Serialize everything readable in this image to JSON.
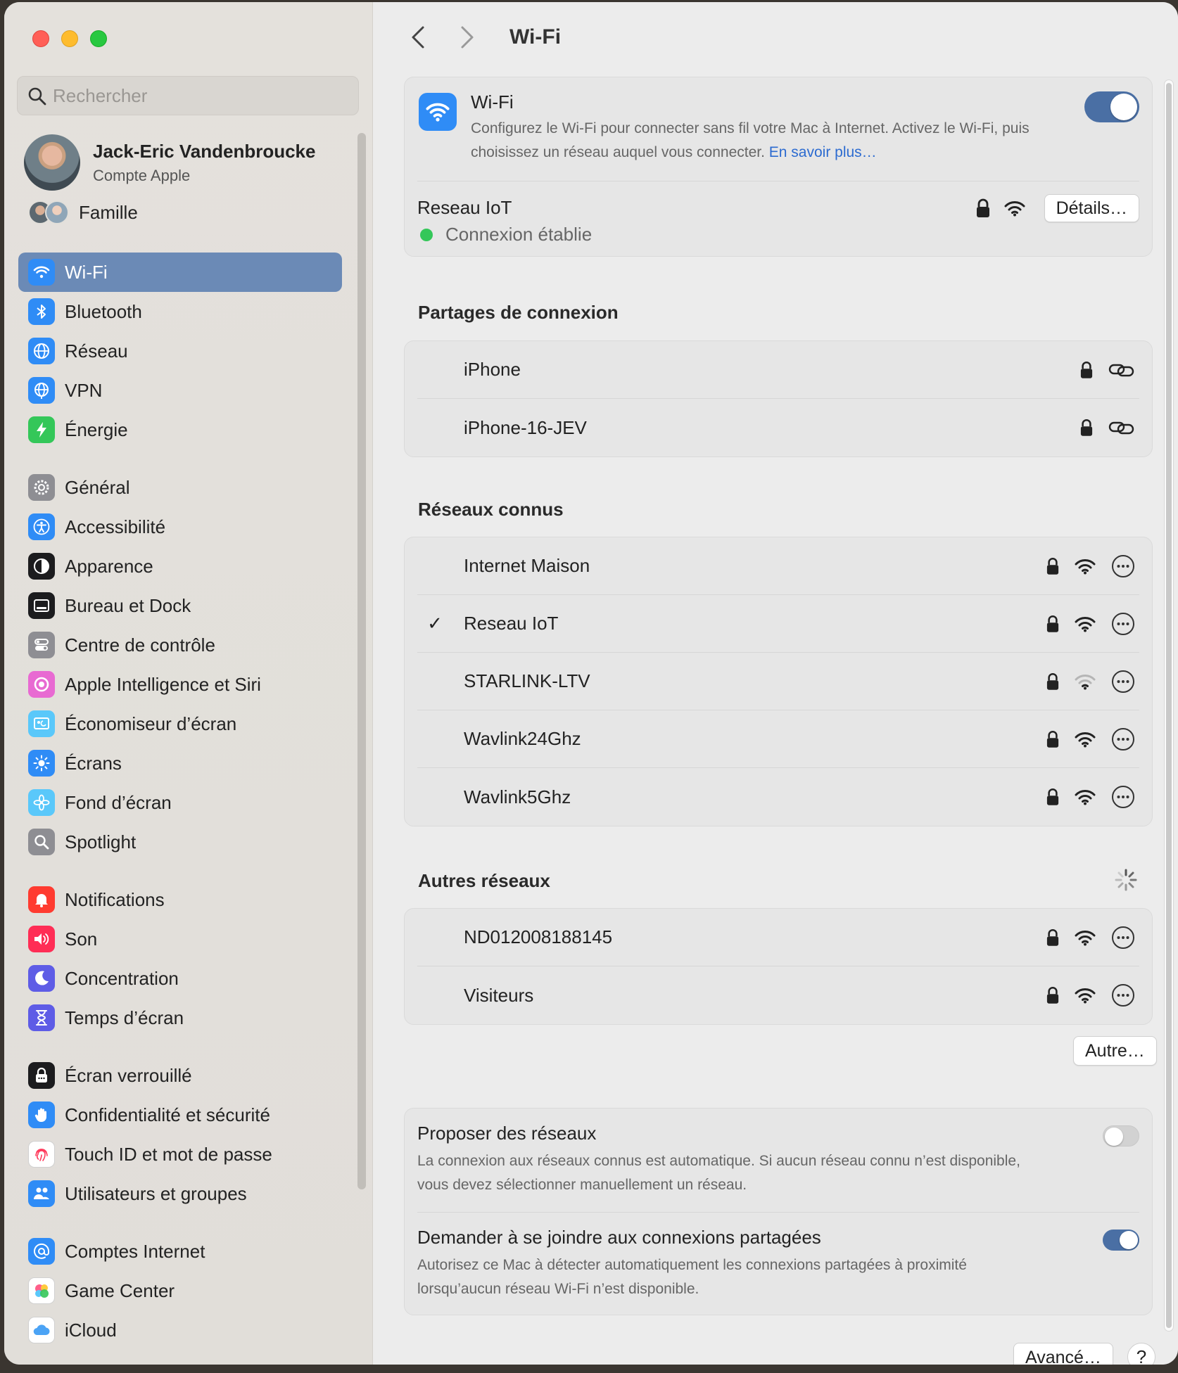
{
  "sidebar": {
    "search_placeholder": "Rechercher",
    "profile": {
      "name": "Jack-Eric Vandenbroucke",
      "subtitle": "Compte Apple"
    },
    "family_label": "Famille",
    "groups": [
      [
        {
          "label": "Wi-Fi",
          "icon": "wifi-icon",
          "color": "#2f8cf6",
          "active": true
        },
        {
          "label": "Bluetooth",
          "icon": "bluetooth-icon",
          "color": "#2f8cf6"
        },
        {
          "label": "Réseau",
          "icon": "globe-icon",
          "color": "#2f8cf6"
        },
        {
          "label": "VPN",
          "icon": "vpn-globe-icon",
          "color": "#2f8cf6"
        },
        {
          "label": "Énergie",
          "icon": "bolt-icon",
          "color": "#34c759"
        }
      ],
      [
        {
          "label": "Général",
          "icon": "gear-icon",
          "color": "#8e8e93"
        },
        {
          "label": "Accessibilité",
          "icon": "accessibility-icon",
          "color": "#2f8cf6"
        },
        {
          "label": "Apparence",
          "icon": "appearance-icon",
          "color": "#1c1c1e"
        },
        {
          "label": "Bureau et Dock",
          "icon": "dock-icon",
          "color": "#1c1c1e"
        },
        {
          "label": "Centre de contrôle",
          "icon": "control-center-icon",
          "color": "#8e8e93"
        },
        {
          "label": "Apple Intelligence et Siri",
          "icon": "siri-icon",
          "color": "#e86ad2"
        },
        {
          "label": "Économiseur d’écran",
          "icon": "screensaver-icon",
          "color": "#5ac8fa"
        },
        {
          "label": "Écrans",
          "icon": "sun-icon",
          "color": "#2f8cf6"
        },
        {
          "label": "Fond d’écran",
          "icon": "flower-icon",
          "color": "#5ac8fa"
        },
        {
          "label": "Spotlight",
          "icon": "spotlight-icon",
          "color": "#8e8e93"
        }
      ],
      [
        {
          "label": "Notifications",
          "icon": "bell-icon",
          "color": "#ff3b30"
        },
        {
          "label": "Son",
          "icon": "speaker-icon",
          "color": "#ff2d55"
        },
        {
          "label": "Concentration",
          "icon": "moon-icon",
          "color": "#5e5ce6"
        },
        {
          "label": "Temps d’écran",
          "icon": "hourglass-icon",
          "color": "#5e5ce6"
        }
      ],
      [
        {
          "label": "Écran verrouillé",
          "icon": "lock-screen-icon",
          "color": "#1c1c1e"
        },
        {
          "label": "Confidentialité et sécurité",
          "icon": "hand-icon",
          "color": "#2f8cf6"
        },
        {
          "label": "Touch ID et mot de passe",
          "icon": "fingerprint-icon",
          "color": "#ffffff"
        },
        {
          "label": "Utilisateurs et groupes",
          "icon": "users-icon",
          "color": "#2f8cf6"
        }
      ],
      [
        {
          "label": "Comptes Internet",
          "icon": "at-icon",
          "color": "#2f8cf6"
        },
        {
          "label": "Game Center",
          "icon": "game-center-icon",
          "color": "#ffffff"
        },
        {
          "label": "iCloud",
          "icon": "cloud-icon",
          "color": "#ffffff"
        }
      ]
    ]
  },
  "toolbar": {
    "title": "Wi-Fi"
  },
  "wifi": {
    "title": "Wi-Fi",
    "description": "Configurez le Wi-Fi pour connecter sans fil votre Mac à Internet. Activez le Wi-Fi, puis choisissez un réseau auquel vous connecter.",
    "link": "En savoir plus…",
    "enabled": true,
    "current_network": "Reseau IoT",
    "status": "Connexion établie",
    "details_button": "Détails…"
  },
  "hotspots": {
    "title": "Partages de connexion",
    "items": [
      "iPhone",
      "iPhone-16-JEV"
    ]
  },
  "known": {
    "title": "Réseaux connus",
    "items": [
      {
        "name": "Internet Maison",
        "checked": false,
        "signal": 3
      },
      {
        "name": "Reseau IoT",
        "checked": true,
        "signal": 3
      },
      {
        "name": "STARLINK-LTV",
        "checked": false,
        "signal": 1
      },
      {
        "name": "Wavlink24Ghz",
        "checked": false,
        "signal": 3
      },
      {
        "name": "Wavlink5Ghz",
        "checked": false,
        "signal": 3
      }
    ],
    "check_glyph": "✓"
  },
  "others": {
    "title": "Autres réseaux",
    "items": [
      {
        "name": "ND012008188145",
        "signal": 3
      },
      {
        "name": "Visiteurs",
        "signal": 3
      }
    ],
    "other_button": "Autre…"
  },
  "settings": [
    {
      "title": "Proposer des réseaux",
      "description": "La connexion aux réseaux connus est automatique. Si aucun réseau connu n’est disponible, vous devez sélectionner manuellement un réseau.",
      "enabled": false
    },
    {
      "title": "Demander à se joindre aux connexions partagées",
      "description": "Autorisez ce Mac à détecter automatiquement les connexions partagées à proximité lorsqu’aucun réseau Wi-Fi n’est disponible.",
      "enabled": true
    }
  ],
  "footer": {
    "advanced_button": "Avancé…",
    "help_button": "?"
  },
  "colors": {
    "accent": "#4a6fa4",
    "connected": "#34c759",
    "link": "#2c6bd0"
  }
}
